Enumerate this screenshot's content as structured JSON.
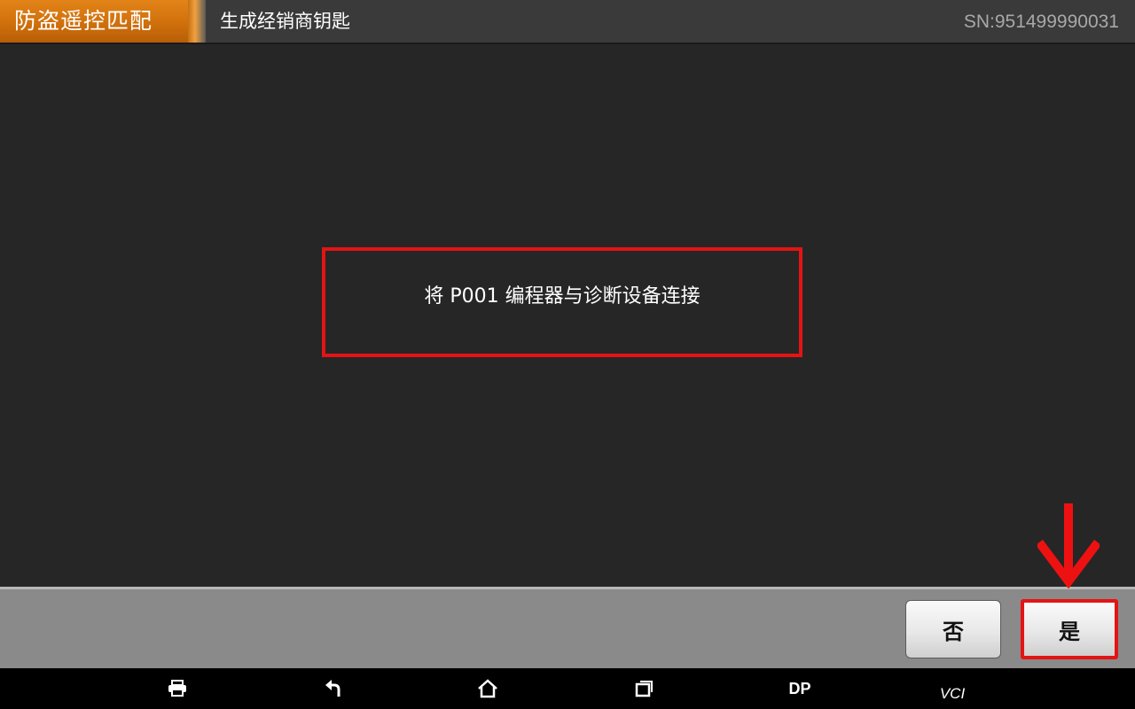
{
  "header": {
    "module_title": "防盗遥控匹配",
    "subtitle": "生成经销商钥匙",
    "serial": "SN:951499990031"
  },
  "dialog": {
    "message": "将 P001 编程器与诊断设备连接"
  },
  "actions": {
    "no_label": "否",
    "yes_label": "是"
  },
  "navbar": {
    "items": [
      {
        "icon": "print-icon"
      },
      {
        "icon": "back-icon"
      },
      {
        "icon": "home-icon"
      },
      {
        "icon": "recent-apps-icon"
      },
      {
        "label": "DP"
      },
      {
        "label": "VCI"
      }
    ]
  },
  "colors": {
    "accent": "#d0700c",
    "highlight": "#e41414",
    "background": "#262626",
    "action_bar": "#8a8a8a"
  }
}
